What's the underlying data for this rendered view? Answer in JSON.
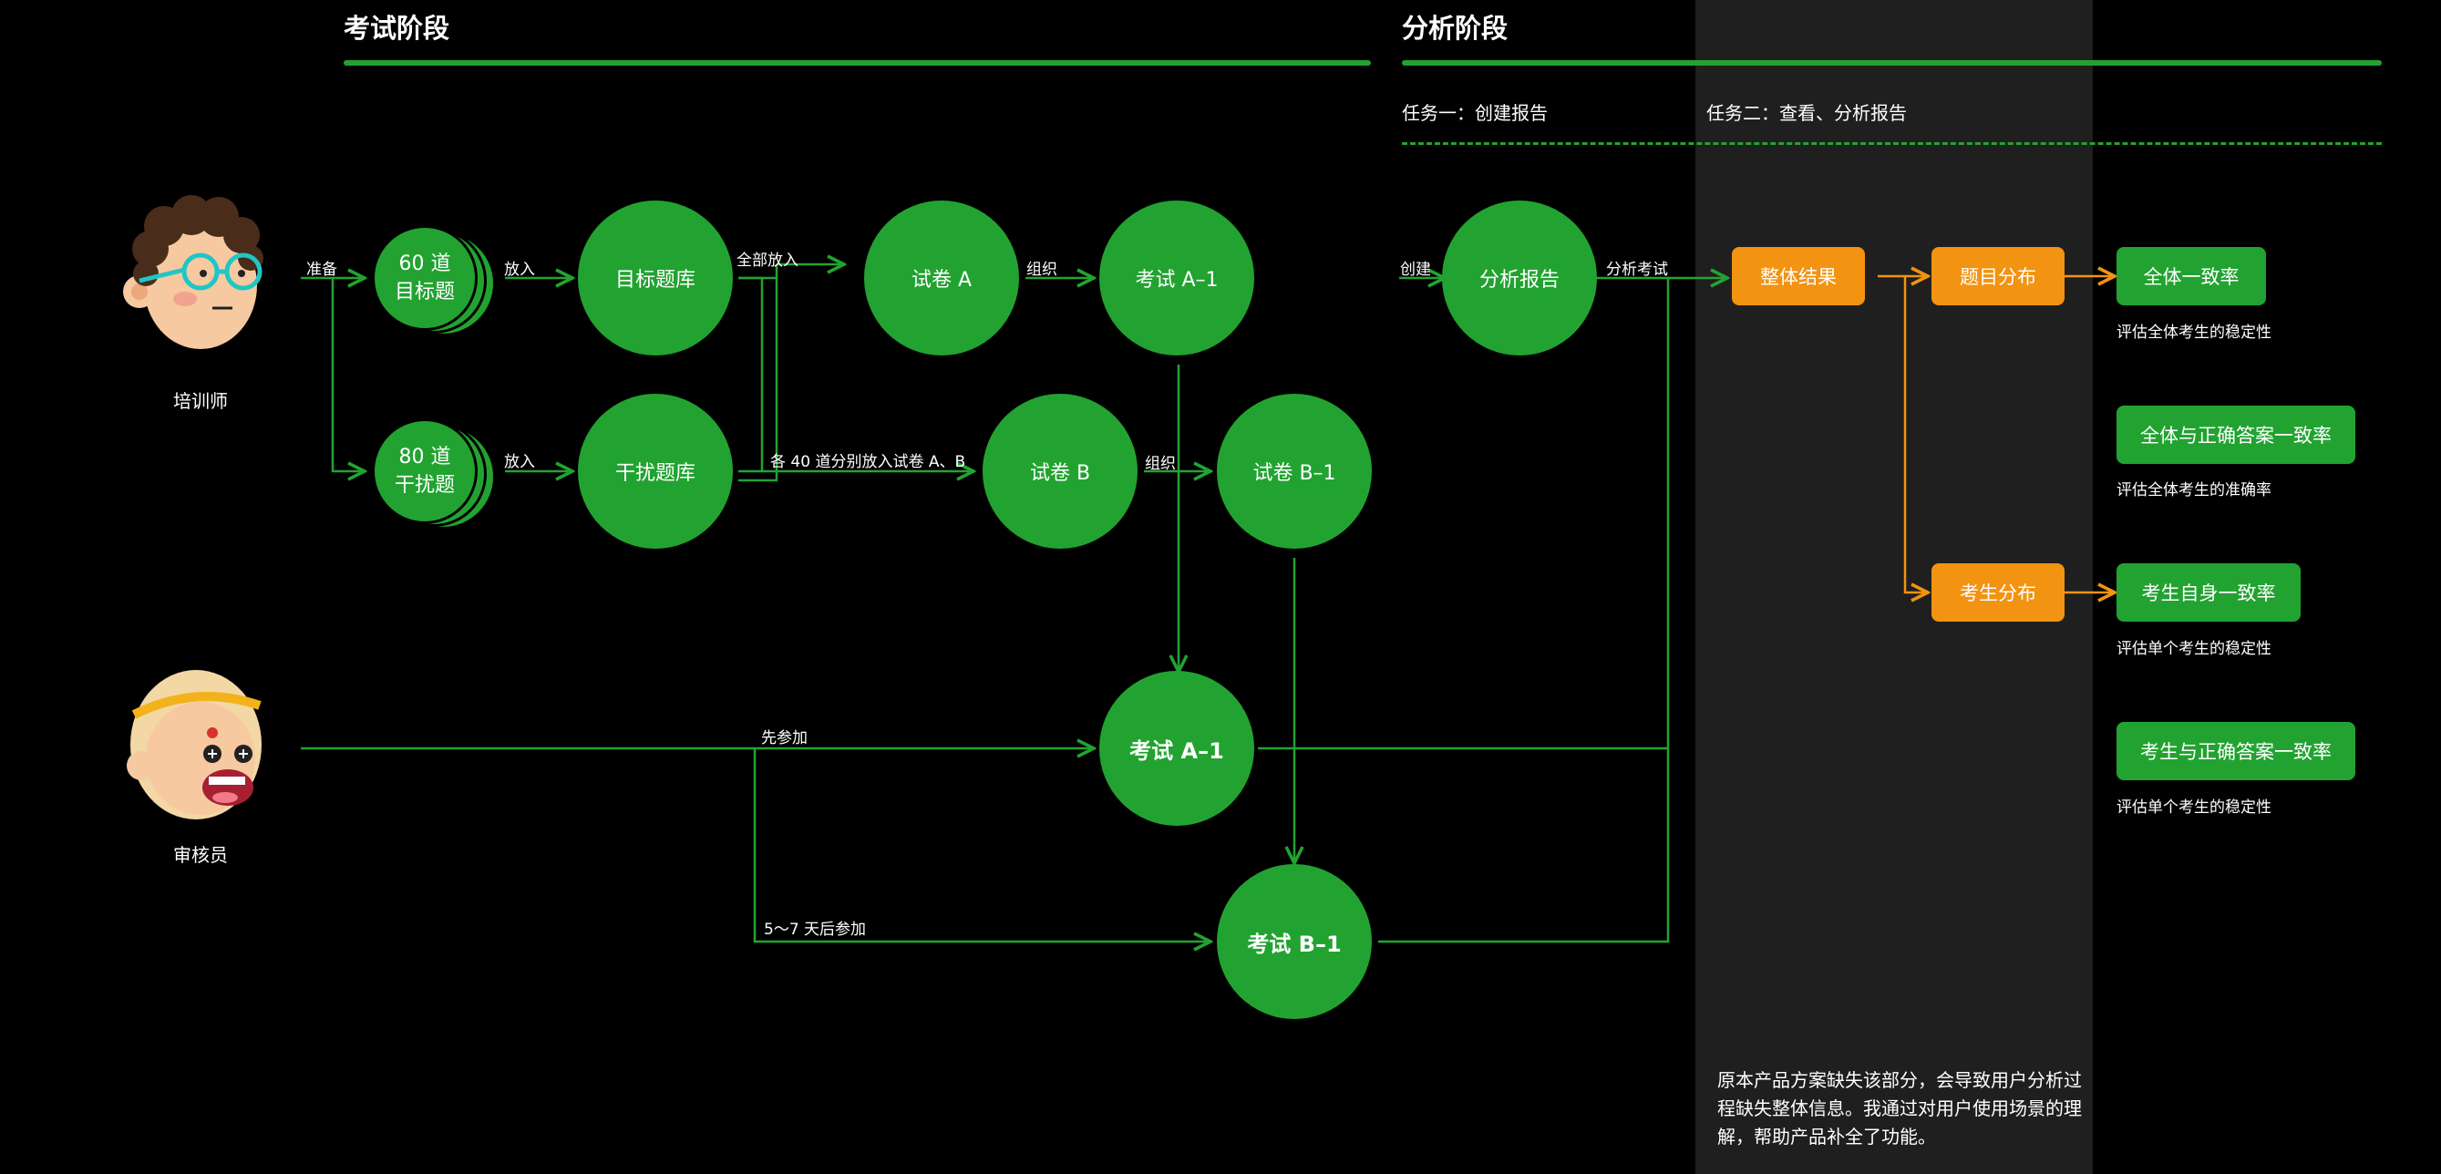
{
  "phases": {
    "exam": "考试阶段",
    "analysis": "分析阶段"
  },
  "tasks": {
    "task1": "任务一：创建报告",
    "task2": "任务二：查看、分析报告"
  },
  "roles": {
    "trainer": "培训师",
    "reviewer": "审核员"
  },
  "nodes": {
    "q60_num": "60 道",
    "q60_label": "目标题",
    "q80_num": "80 道",
    "q80_label": "干扰题",
    "target_bank": "目标题库",
    "distract_bank": "干扰题库",
    "paper_a": "试卷 A",
    "paper_b": "试卷 B",
    "exam_a1_top": "考试 A–1",
    "exam_b1_top": "试卷 B–1",
    "exam_a1": "考试 A–1",
    "exam_b1": "考试 B–1",
    "report": "分析报告",
    "overall": "整体结果",
    "question_dist": "题目分布",
    "examinee_dist": "考生分布",
    "r1": "全体一致率",
    "r2": "全体与正确答案一致率",
    "r3": "考生自身一致率",
    "r4": "考生与正确答案一致率"
  },
  "edge_labels": {
    "prepare": "准备",
    "put_in_1": "放入",
    "put_in_2": "放入",
    "all_in": "全部放入",
    "each_40": "各 40 道分别放入试卷 A、B",
    "organize_1": "组织",
    "organize_2": "组织",
    "first_join": "先参加",
    "later_join": "5～7 天后参加",
    "create": "创建",
    "analyze": "分析考试"
  },
  "descriptions": {
    "d1": "评估全体考生的稳定性",
    "d2": "评估全体考生的准确率",
    "d3": "评估单个考生的稳定性",
    "d4": "评估单个考生的稳定性"
  },
  "note": "原本产品方案缺失该部分，会导致用户分析过程缺失整体信息。我通过对用户使用场景的理解，帮助产品补全了功能。",
  "colors": {
    "green": "#22a331",
    "orange": "#f29312",
    "panel": "#1f1f1f",
    "background": "#000000"
  }
}
